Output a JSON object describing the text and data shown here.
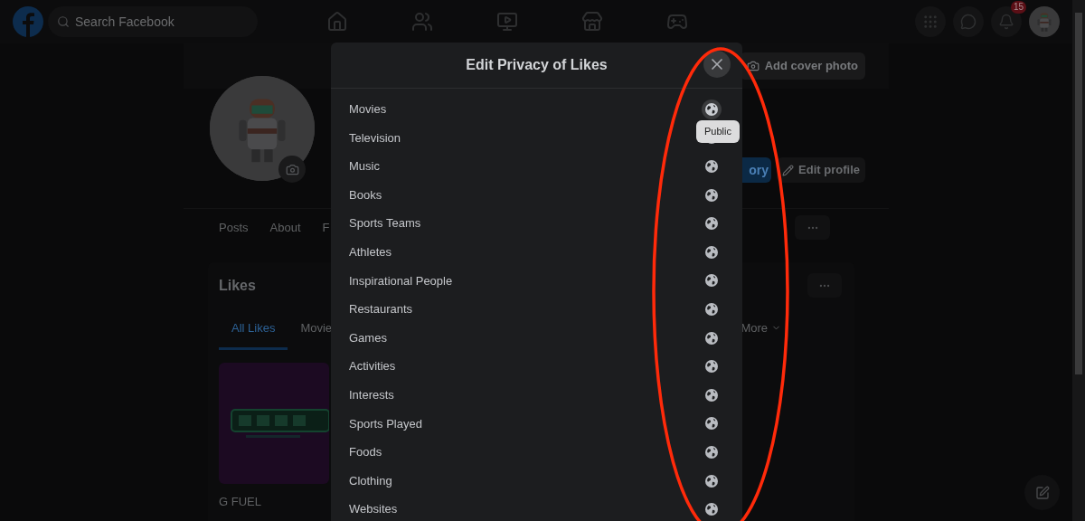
{
  "top_bar": {
    "search": {
      "placeholder": "Search Facebook"
    },
    "notification_count": "15"
  },
  "profile": {
    "cover_button": "Add cover photo",
    "story_button": "ory",
    "edit_button": "Edit profile",
    "tabs": [
      "Posts",
      "About",
      "F"
    ]
  },
  "likes": {
    "title": "Likes",
    "tabs": [
      {
        "label": "All Likes",
        "selected": true
      },
      {
        "label": "Movie",
        "selected": false
      },
      {
        "label": "More",
        "selected": false
      }
    ],
    "items": [
      {
        "name": "G FUEL",
        "kind": "picture"
      }
    ]
  },
  "modal": {
    "title": "Edit Privacy of Likes",
    "tooltip": "Public",
    "categories": [
      {
        "label": "Movies",
        "hovered": true
      },
      {
        "label": "Television",
        "hovered": false
      },
      {
        "label": "Music",
        "hovered": false
      },
      {
        "label": "Books",
        "hovered": false
      },
      {
        "label": "Sports Teams",
        "hovered": false
      },
      {
        "label": "Athletes",
        "hovered": false
      },
      {
        "label": "Inspirational People",
        "hovered": false
      },
      {
        "label": "Restaurants",
        "hovered": false
      },
      {
        "label": "Games",
        "hovered": false
      },
      {
        "label": "Activities",
        "hovered": false
      },
      {
        "label": "Interests",
        "hovered": false
      },
      {
        "label": "Sports Played",
        "hovered": false
      },
      {
        "label": "Foods",
        "hovered": false
      },
      {
        "label": "Clothing",
        "hovered": false
      },
      {
        "label": "Websites",
        "hovered": false
      }
    ]
  },
  "annotation": {
    "kind": "ellipse"
  }
}
